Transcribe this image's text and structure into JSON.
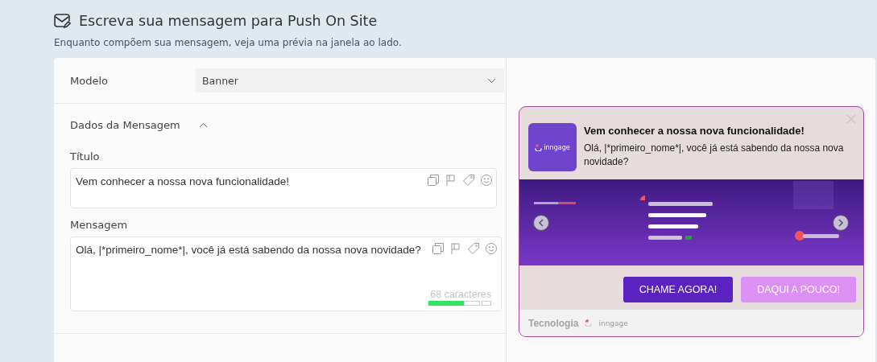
{
  "header": {
    "title": "Escreva sua mensagem para Push On Site",
    "subtitle": "Enquanto compõem sua mensagem, veja uma prévia na janela ao lado."
  },
  "form": {
    "model": {
      "label": "Modelo",
      "value": "Banner"
    },
    "section": {
      "title": "Dados da Mensagem",
      "expanded": true
    },
    "fields": [
      {
        "label": "Título",
        "value": "Vem conhecer a nossa nova funcionalidade!",
        "kind": "title"
      },
      {
        "label": "Mensagem",
        "value": "Olá, |*primeiro_nome*|, você já está sabendo da nossa nova novidade?",
        "kind": "message",
        "counter": "68 caracteres",
        "level": 0.57
      }
    ]
  },
  "preview": {
    "logo_text": "inngage",
    "title": "Vem conhecer a nossa nova funcionalidade!",
    "body": "Olá, |*primeiro_nome*|, você já está sabendo da nossa nova novidade?",
    "buttons": [
      {
        "label": "CHAME AGORA!",
        "kind": "primary"
      },
      {
        "label": "DAQUI A POUCO!",
        "kind": "secondary"
      }
    ],
    "footer": {
      "text": "Tecnologia",
      "brand": "inngage"
    }
  }
}
